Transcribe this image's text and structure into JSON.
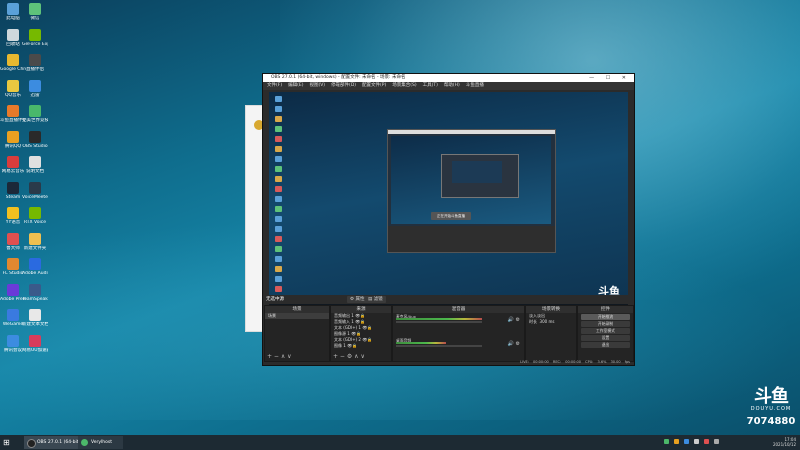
{
  "desktop_icons": [
    {
      "label": "此电脑",
      "color": "#5aa0d8"
    },
    {
      "label": "微信",
      "color": "#5ec27a"
    },
    {
      "label": "回收站",
      "color": "#cfd8dc"
    },
    {
      "label": "GeForce Experience",
      "color": "#76b900"
    },
    {
      "label": "Google Chrome",
      "color": "#e8b830"
    },
    {
      "label": "直播伴侣",
      "color": "#4a4a4a"
    },
    {
      "label": "QQ音乐",
      "color": "#e8c840"
    },
    {
      "label": "迅雷",
      "color": "#3c8ce0"
    },
    {
      "label": "斗鱼直播伴侣",
      "color": "#e87a2a"
    },
    {
      "label": "完美世界竞技平台",
      "color": "#49b86b"
    },
    {
      "label": "腾讯QQ",
      "color": "#e8a020"
    },
    {
      "label": "OBS Studio",
      "color": "#2a2a2a"
    },
    {
      "label": "网易云音乐",
      "color": "#d93c3c"
    },
    {
      "label": "说明文档",
      "color": "#e0e0e0"
    },
    {
      "label": "Steam",
      "color": "#1b2838"
    },
    {
      "label": "VoiceMeeter",
      "color": "#2a3a4a"
    },
    {
      "label": "YY语音",
      "color": "#f0c020"
    },
    {
      "label": "RTX Voice",
      "color": "#76b900"
    },
    {
      "label": "鲁大师",
      "color": "#e05050"
    },
    {
      "label": "新建文件夹",
      "color": "#f0c050"
    },
    {
      "label": "FL Studio",
      "color": "#e08830"
    },
    {
      "label": "Adobe Audition",
      "color": "#2a6ae0"
    },
    {
      "label": "Adobe Premiere",
      "color": "#6a3ad8"
    },
    {
      "label": "TeamSpeak",
      "color": "#3a5a8a"
    },
    {
      "label": "WeGame",
      "color": "#3a7ae0"
    },
    {
      "label": "新建文本文档",
      "color": "#e8e8e8"
    },
    {
      "label": "腾讯会议",
      "color": "#3c8ce0"
    },
    {
      "label": "网易UU加速器",
      "color": "#d83c5c"
    }
  ],
  "obs": {
    "title": "OBS 27.0.1 (64-bit, windows) - 配置文件: 未命名 - 场景: 未命名",
    "menu": [
      "文件(F)",
      "编辑(E)",
      "视图(V)",
      "停靠部件(D)",
      "配置文件(P)",
      "场景集合(S)",
      "工具(T)",
      "帮助(H)",
      "斗鱼直播"
    ],
    "no_source_label": "无选中源",
    "properties_label": "属性",
    "filters_label": "滤镜",
    "preview_toast": "正在开始斗鱼直播",
    "preview_logo": "斗鱼",
    "docks": {
      "scenes": {
        "title": "场景",
        "items": [
          "场景"
        ]
      },
      "sources": {
        "title": "来源",
        "items": [
          "音频输出 1",
          "音频输入 1",
          "文本 (GDI+) 1",
          "图像源 1",
          "文本 (GDI+) 2",
          "图像 1"
        ]
      },
      "mixer": {
        "title": "混音器",
        "channels": [
          "麦克风/Aux",
          "桌面音频"
        ]
      },
      "transitions": {
        "title": "场景转换",
        "type": "淡入淡出",
        "duration_label": "时长",
        "duration": "300 ms"
      },
      "controls": {
        "title": "控件",
        "buttons": [
          "开始推流",
          "开始录制",
          "工作室模式",
          "设置",
          "退出"
        ]
      }
    },
    "status": [
      "LIVE: 00:00:00",
      "REC: 00:00:00",
      "CPU: 3.6%",
      "30.00 fps"
    ]
  },
  "overlay": {
    "brand": "斗鱼",
    "brand_sub": "DOUYU.COM",
    "room_number": "7074880"
  },
  "taskbar": {
    "apps": [
      {
        "label": "OBS 27.0.1 (64-bit)...",
        "color": "#222"
      },
      {
        "label": "Verylhost",
        "color": "#4cb86a"
      }
    ],
    "time": "17:04",
    "date": "2021/10/12"
  }
}
